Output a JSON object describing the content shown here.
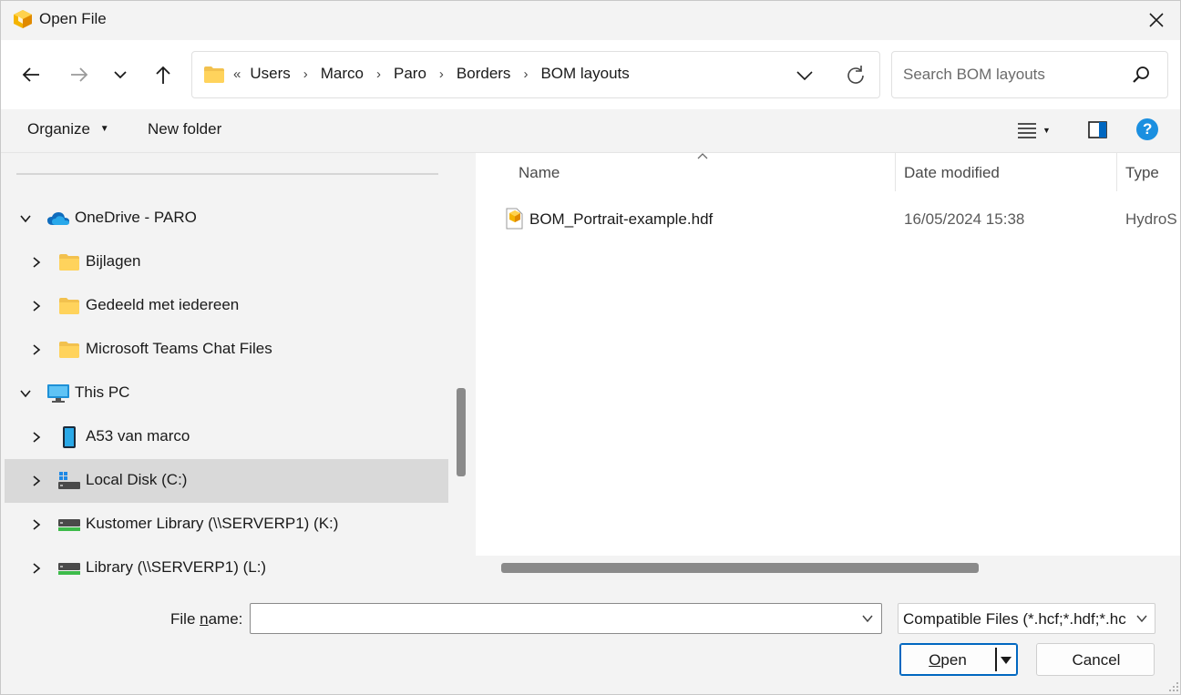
{
  "window": {
    "title": "Open File",
    "accent": "#0067c0"
  },
  "nav": {
    "back_icon": "arrow-left-icon",
    "forward_icon": "arrow-right-icon",
    "recent_icon": "chevron-down-icon",
    "up_icon": "arrow-up-icon"
  },
  "address": {
    "overflow": "«",
    "crumbs": [
      "Users",
      "Marco",
      "Paro",
      "Borders",
      "BOM layouts"
    ]
  },
  "search": {
    "placeholder": "Search BOM layouts"
  },
  "toolbar": {
    "organize": "Organize",
    "new_folder": "New folder",
    "help": "?"
  },
  "tree": {
    "items": [
      {
        "label": "OneDrive - PARO",
        "icon": "cloud-icon",
        "expanded": true
      },
      {
        "label": "Bijlagen",
        "icon": "folder-icon"
      },
      {
        "label": "Gedeeld met iedereen",
        "icon": "folder-icon"
      },
      {
        "label": "Microsoft Teams Chat Files",
        "icon": "folder-icon"
      },
      {
        "label": "This PC",
        "icon": "monitor-icon",
        "expanded": true
      },
      {
        "label": "A53 van marco",
        "icon": "phone-icon"
      },
      {
        "label": "Local Disk (C:)",
        "icon": "disk-icon",
        "selected": true
      },
      {
        "label": "Kustomer Library (\\\\SERVERP1) (K:)",
        "icon": "network-drive-icon"
      },
      {
        "label": "Library (\\\\SERVERP1) (L:)",
        "icon": "network-drive-icon"
      }
    ]
  },
  "files": {
    "columns": {
      "name": "Name",
      "date": "Date modified",
      "type": "Type"
    },
    "rows": [
      {
        "name": "BOM_Portrait-example.hdf",
        "date": "16/05/2024 15:38",
        "type": "HydroS"
      }
    ]
  },
  "footer": {
    "filename_label_pre": "File ",
    "filename_label_u": "n",
    "filename_label_post": "ame:",
    "filename_value": "",
    "filter": "Compatible Files (*.hcf;*.hdf;*.hc",
    "open_u": "O",
    "open_rest": "pen",
    "cancel": "Cancel"
  }
}
